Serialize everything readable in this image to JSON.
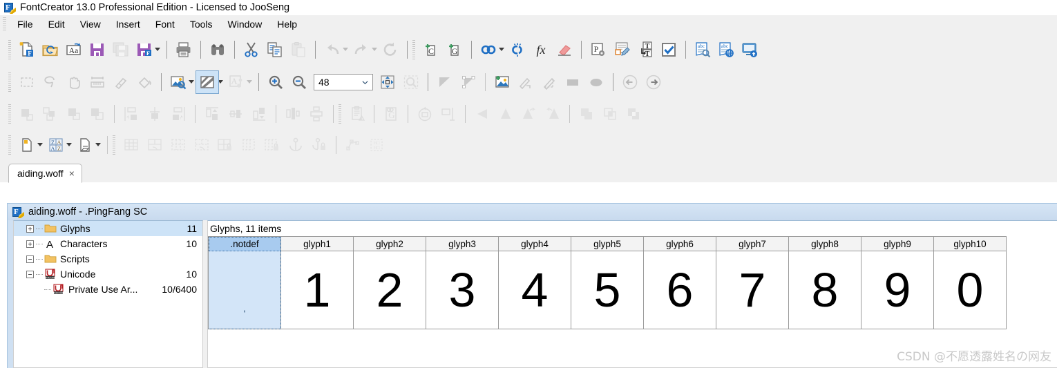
{
  "window": {
    "title": "FontCreator 13.0 Professional Edition - Licensed to JooSeng",
    "app_icon": "fontcreator-icon"
  },
  "menubar": {
    "items": [
      {
        "label": "File"
      },
      {
        "label": "Edit"
      },
      {
        "label": "View"
      },
      {
        "label": "Insert"
      },
      {
        "label": "Font"
      },
      {
        "label": "Tools"
      },
      {
        "label": "Window"
      },
      {
        "label": "Help"
      }
    ]
  },
  "toolbars": {
    "row1": [
      {
        "name": "new-font-button",
        "icon": "new-font-icon",
        "enabled": true
      },
      {
        "name": "open-font-button",
        "icon": "open-folder-icon",
        "enabled": true
      },
      {
        "name": "install-font-button",
        "icon": "font-aa-icon",
        "enabled": true
      },
      {
        "name": "save-button",
        "icon": "save-icon",
        "enabled": true
      },
      {
        "name": "save-all-button",
        "icon": "save-all-icon",
        "enabled": false
      },
      {
        "name": "save-as-button",
        "icon": "save-as-icon",
        "enabled": true,
        "dropdown": true
      },
      {
        "name": "print-button",
        "icon": "printer-icon",
        "enabled": true
      },
      {
        "name": "find-button",
        "icon": "binoculars-icon",
        "enabled": true
      },
      {
        "name": "cut-button",
        "icon": "scissors-icon",
        "enabled": true
      },
      {
        "name": "copy-button",
        "icon": "copy-icon",
        "enabled": true
      },
      {
        "name": "paste-button",
        "icon": "paste-icon",
        "enabled": false
      },
      {
        "name": "undo-button",
        "icon": "undo-icon",
        "enabled": false,
        "dropdown": true
      },
      {
        "name": "redo-button",
        "icon": "redo-icon",
        "enabled": false,
        "dropdown": true
      },
      {
        "name": "reload-button",
        "icon": "refresh-icon",
        "enabled": false
      },
      {
        "name": "add-character-button",
        "icon": "add-character-icon",
        "enabled": true
      },
      {
        "name": "add-glyph-button",
        "icon": "add-glyph-icon",
        "enabled": true
      },
      {
        "name": "link-glyph-button",
        "icon": "link-icon",
        "enabled": true,
        "dropdown": true
      },
      {
        "name": "unlink-glyph-button",
        "icon": "unlink-icon",
        "enabled": true
      },
      {
        "name": "script-function-button",
        "icon": "fx-icon",
        "enabled": true
      },
      {
        "name": "clear-button",
        "icon": "eraser-icon",
        "enabled": true
      },
      {
        "name": "font-properties-button",
        "icon": "properties-gear-icon",
        "enabled": true
      },
      {
        "name": "edit-metadata-button",
        "icon": "edit-table-icon",
        "enabled": true
      },
      {
        "name": "transform-text-button",
        "icon": "transform-text-icon",
        "enabled": true
      },
      {
        "name": "validate-button",
        "icon": "checkmark-icon",
        "enabled": true
      },
      {
        "name": "test-font-button",
        "icon": "abc-preview-icon",
        "enabled": true
      },
      {
        "name": "webfont-preview-button",
        "icon": "abc-web-icon",
        "enabled": true
      },
      {
        "name": "publish-font-button",
        "icon": "publish-screen-icon",
        "enabled": true
      }
    ],
    "row2": [
      {
        "name": "rectangle-select-tool",
        "icon": "marquee-select-icon",
        "enabled": false
      },
      {
        "name": "lasso-select-tool",
        "icon": "lasso-icon",
        "enabled": false
      },
      {
        "name": "pan-tool",
        "icon": "hand-icon",
        "enabled": false
      },
      {
        "name": "measure-tool",
        "icon": "ruler-icon",
        "enabled": false
      },
      {
        "name": "knife-tool",
        "icon": "knife-icon",
        "enabled": false
      },
      {
        "name": "fill-tool",
        "icon": "paint-bucket-icon",
        "enabled": false
      },
      {
        "name": "image-preview-button",
        "icon": "image-zoom-icon",
        "enabled": true,
        "dropdown": true
      },
      {
        "name": "contour-fill-button",
        "icon": "diagonal-fill-icon",
        "enabled": true,
        "active": true,
        "dropdown": true
      },
      {
        "name": "glyph-metrics-button",
        "icon": "font-metrics-icon",
        "enabled": false,
        "dropdown": true
      },
      {
        "name": "zoom-in-button",
        "icon": "zoom-in-icon",
        "enabled": true
      },
      {
        "name": "zoom-out-button",
        "icon": "zoom-out-icon",
        "enabled": true
      },
      {
        "name": "fit-to-window-button",
        "icon": "fit-window-icon",
        "enabled": true
      },
      {
        "name": "zoom-selection-button",
        "icon": "zoom-selection-icon",
        "enabled": false
      },
      {
        "name": "corner-point-button",
        "icon": "filled-triangle-icon",
        "enabled": false
      },
      {
        "name": "curve-point-button",
        "icon": "outline-triangle-icon",
        "enabled": false
      },
      {
        "name": "add-image-button",
        "icon": "add-image-icon",
        "enabled": true
      },
      {
        "name": "freehand-tool",
        "icon": "brush-icon",
        "enabled": false
      },
      {
        "name": "pen-tool",
        "icon": "pencil-icon",
        "enabled": false
      },
      {
        "name": "rectangle-tool",
        "icon": "rectangle-icon",
        "enabled": false
      },
      {
        "name": "ellipse-tool",
        "icon": "ellipse-icon",
        "enabled": false
      },
      {
        "name": "previous-glyph-button",
        "icon": "arrow-left-circle-icon",
        "enabled": false
      },
      {
        "name": "next-glyph-button",
        "icon": "arrow-right-circle-icon",
        "enabled": false
      }
    ],
    "row3": [
      {
        "name": "align-left-button",
        "icon": "align-left-icon",
        "enabled": false
      },
      {
        "name": "distribute-button",
        "icon": "distribute-icon",
        "enabled": false
      },
      {
        "name": "align-center-h-button",
        "icon": "align-center-h-icon",
        "enabled": false
      },
      {
        "name": "align-right-button",
        "icon": "align-right-icon",
        "enabled": false
      },
      {
        "name": "move-to-left-sidebearing-button",
        "icon": "snap-left-icon",
        "enabled": false
      },
      {
        "name": "center-in-advance-width-button",
        "icon": "center-advance-icon",
        "enabled": false
      },
      {
        "name": "move-to-right-sidebearing-button",
        "icon": "snap-right-icon",
        "enabled": false
      },
      {
        "name": "align-to-ascender-button",
        "icon": "align-top-icon",
        "enabled": false
      },
      {
        "name": "align-to-baseline-button",
        "icon": "align-middle-icon",
        "enabled": false
      },
      {
        "name": "align-to-descender-button",
        "icon": "align-bottom-icon",
        "enabled": false
      },
      {
        "name": "center-vertical-button",
        "icon": "center-vertical-icon",
        "enabled": false
      },
      {
        "name": "center-horizontal-button",
        "icon": "center-horizontal-icon",
        "enabled": false
      },
      {
        "name": "paste-special-button",
        "icon": "clipboard-warning-icon",
        "enabled": false
      },
      {
        "name": "copy-glyph-button",
        "icon": "glyph-g-icon",
        "enabled": false
      },
      {
        "name": "rotate-button",
        "icon": "rotate-icon",
        "enabled": false
      },
      {
        "name": "snap-button",
        "icon": "snap-to-grid-icon",
        "enabled": false
      },
      {
        "name": "flip-horizontal-button",
        "icon": "flip-h-icon",
        "enabled": false
      },
      {
        "name": "flip-vertical-button",
        "icon": "flip-v-icon",
        "enabled": false
      },
      {
        "name": "slant-left-button",
        "icon": "slant-left-icon",
        "enabled": false
      },
      {
        "name": "slant-right-button",
        "icon": "slant-right-icon",
        "enabled": false
      },
      {
        "name": "union-button",
        "icon": "union-icon",
        "enabled": false
      },
      {
        "name": "intersect-button",
        "icon": "intersect-icon",
        "enabled": false
      },
      {
        "name": "exclude-button",
        "icon": "exclude-icon",
        "enabled": false
      }
    ],
    "row4": [
      {
        "name": "new-page-button",
        "icon": "page-icon",
        "enabled": true,
        "dropdown": true
      },
      {
        "name": "sort-glyphs-button",
        "icon": "sort-za-icon",
        "enabled": true,
        "dropdown": true
      },
      {
        "name": "page-options-button",
        "icon": "page-list-icon",
        "enabled": true,
        "dropdown": true
      },
      {
        "name": "insert-table-button",
        "icon": "grid-icon",
        "enabled": false
      },
      {
        "name": "merge-cells-button",
        "icon": "grid-merge-icon",
        "enabled": false
      },
      {
        "name": "table-grid-button",
        "icon": "grid-dotted-icon",
        "enabled": false
      },
      {
        "name": "table-merge-button",
        "icon": "grid-dotted-merge-icon",
        "enabled": false
      },
      {
        "name": "lock-rows-button",
        "icon": "grid-row-lock-icon",
        "enabled": false
      },
      {
        "name": "columns-button",
        "icon": "columns-icon",
        "enabled": false
      },
      {
        "name": "lock-columns-button",
        "icon": "columns-lock-icon",
        "enabled": false
      },
      {
        "name": "anchor-button",
        "icon": "anchor-icon",
        "enabled": false
      },
      {
        "name": "anchor-lock-button",
        "icon": "anchor-lock-icon",
        "enabled": false
      },
      {
        "name": "path-nodes-button",
        "icon": "path-nodes-icon",
        "enabled": false
      },
      {
        "name": "kerning-pairs-button",
        "icon": "kerning-icon",
        "enabled": false
      }
    ],
    "zoom": {
      "name": "zoom-level-combo",
      "value": "48",
      "placeholder": "48"
    }
  },
  "tabstrip": {
    "tabs": [
      {
        "label": "aiding.woff",
        "close": "×",
        "active": true
      }
    ]
  },
  "document": {
    "title": "aiding.woff - .PingFang SC",
    "icon": "fontcreator-document-icon"
  },
  "tree": {
    "items": [
      {
        "label": "Glyphs",
        "count": "11",
        "icon": "folder-icon",
        "expander": "plus",
        "selected": true,
        "indent": 1
      },
      {
        "label": "Characters",
        "count": "10",
        "icon": "letter-a-icon",
        "expander": "plus",
        "selected": false,
        "indent": 1
      },
      {
        "label": "Scripts",
        "count": "",
        "icon": "folder-icon",
        "expander": "minus",
        "selected": false,
        "indent": 1
      },
      {
        "label": "Unicode",
        "count": "10",
        "icon": "unicode-icon",
        "expander": "minus",
        "selected": false,
        "indent": 1
      },
      {
        "label": "Private Use Ar...",
        "count": "10/6400",
        "icon": "unicode-icon",
        "expander": "none",
        "selected": false,
        "indent": 2
      }
    ]
  },
  "glyphs_panel": {
    "count_label": "Glyphs, 11 items",
    "cells": [
      {
        "header": ".notdef",
        "glyph": "",
        "selected": true,
        "notdef_mark": "ˌ"
      },
      {
        "header": "glyph1",
        "glyph": "1",
        "selected": false
      },
      {
        "header": "glyph2",
        "glyph": "2",
        "selected": false
      },
      {
        "header": "glyph3",
        "glyph": "3",
        "selected": false
      },
      {
        "header": "glyph4",
        "glyph": "4",
        "selected": false
      },
      {
        "header": "glyph5",
        "glyph": "5",
        "selected": false
      },
      {
        "header": "glyph6",
        "glyph": "6",
        "selected": false
      },
      {
        "header": "glyph7",
        "glyph": "7",
        "selected": false
      },
      {
        "header": "glyph8",
        "glyph": "8",
        "selected": false
      },
      {
        "header": "glyph9",
        "glyph": "9",
        "selected": false
      },
      {
        "header": "glyph10",
        "glyph": "0",
        "selected": false
      }
    ]
  },
  "watermark": {
    "text": "CSDN @不愿透露姓名の网友"
  },
  "colors": {
    "selection_blue": "#cde3f7",
    "cell_selection": "#d3e5f8",
    "toolbar_bg": "#f0f0f0",
    "accent_purple": "#9b59b6",
    "accent_blue": "#1f6fc4",
    "watermark_gray": "#c9c9c9"
  }
}
